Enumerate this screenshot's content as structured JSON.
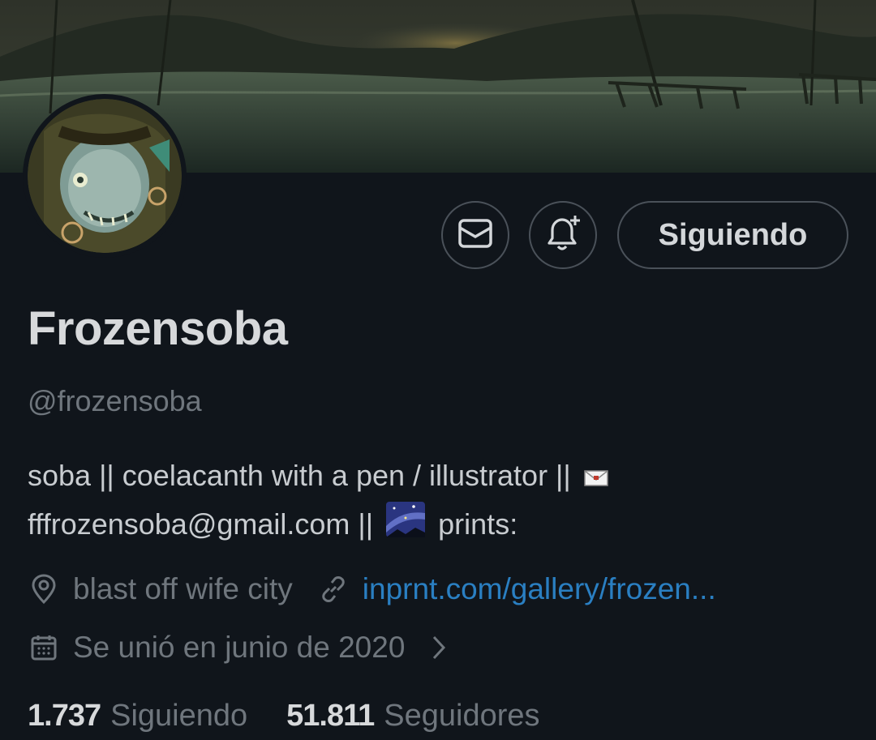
{
  "profile": {
    "name": "Frozensoba",
    "handle": "@frozensoba",
    "bio_line1": "soba || coelacanth with a pen / illustrator ||",
    "bio_line2_email": "fffrozensoba@gmail.com ||",
    "bio_line2_end": "prints:",
    "location": "blast off wife city",
    "website": "inprnt.com/gallery/frozen...",
    "joined": "Se unió en junio de 2020"
  },
  "actions": {
    "message_icon": "envelope-icon",
    "notify_icon": "bell-plus-icon",
    "follow_label": "Siguiendo"
  },
  "stats": {
    "following_count": "1.737",
    "following_label": "Siguiendo",
    "followers_count": "51.811",
    "followers_label": "Seguidores"
  },
  "colors": {
    "background": "#10151b",
    "link": "#2a7fc2",
    "muted": "#6f767d"
  }
}
